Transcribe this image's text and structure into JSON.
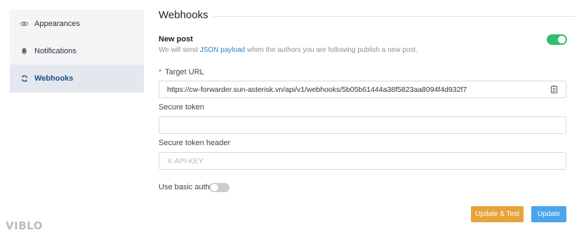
{
  "sidebar": {
    "items": [
      {
        "label": "Appearances",
        "icon": "eye-icon"
      },
      {
        "label": "Notifications",
        "icon": "bell-icon"
      },
      {
        "label": "Webhooks",
        "icon": "sync-icon",
        "active": true
      }
    ]
  },
  "logo": "VIBLO",
  "main": {
    "title": "Webhooks",
    "new_post": {
      "title": "New post",
      "desc_prefix": "We will send ",
      "desc_link": "JSON payload",
      "desc_suffix": " when the authors you are following publish a new post.",
      "enabled": true
    },
    "target_url": {
      "required_mark": "*",
      "label": "Target URL",
      "value": "https://cw-forwarder.sun-asterisk.vn/api/v1/webhooks/5b05b61444a38f5823aa8094f4d932f7"
    },
    "secure_token": {
      "label": "Secure token",
      "value": ""
    },
    "secure_token_header": {
      "label": "Secure token header",
      "placeholder": "X-API-KEY"
    },
    "basic_auth": {
      "label": "Use basic auth",
      "enabled": false
    },
    "buttons": {
      "update_test": "Update & Test",
      "update": "Update"
    }
  },
  "colors": {
    "accent": "#2f80c4",
    "toggle_on": "#2ebf6a",
    "btn_test": "#e8a33d",
    "btn_update": "#4aa5ec"
  }
}
